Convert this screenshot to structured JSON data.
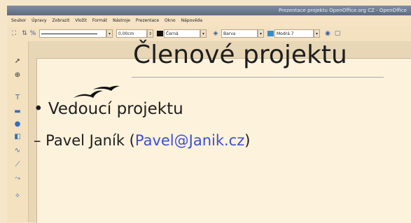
{
  "window": {
    "title": "Prezentace projektu OpenOffice.org CZ - OpenOffice"
  },
  "menu": {
    "items": [
      "Soubor",
      "Úpravy",
      "Zobrazit",
      "Vložit",
      "Formát",
      "Nástroje",
      "Prezentace",
      "Okno",
      "Nápověda"
    ]
  },
  "toolbar": {
    "line_width": "0,00cm",
    "line_color": "Černá",
    "area_style": "Barva",
    "area_color": "Modrá 7"
  },
  "slide": {
    "title": "Členové projektu",
    "bullet1": "Vedoucí projektu",
    "bullet2_prefix": "– Pavel Janík (",
    "bullet2_email": "Pavel@Janik.cz",
    "bullet2_suffix": ")"
  },
  "colors": {
    "background": "#f6e6c9",
    "title_bar": "#6d7c92",
    "email_link": "#3b4fd6"
  }
}
